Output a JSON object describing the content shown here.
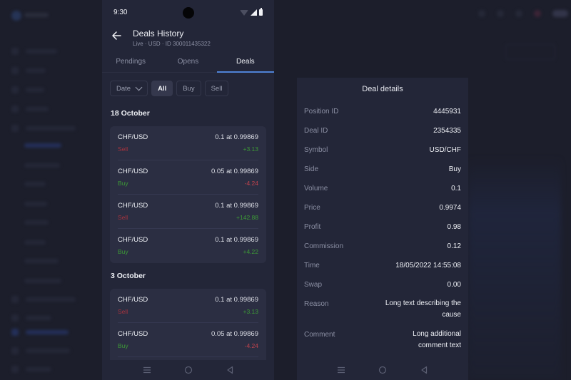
{
  "phone": {
    "status_time": "9:30",
    "header": {
      "title": "Deals History",
      "subtitle": "Live · USD · ID 300011435322"
    },
    "tabs": [
      {
        "label": "Pendings",
        "active": false
      },
      {
        "label": "Opens",
        "active": false
      },
      {
        "label": "Deals",
        "active": true
      }
    ],
    "filters": {
      "date_label": "Date",
      "options": [
        {
          "label": "All",
          "active": true
        },
        {
          "label": "Buy",
          "active": false
        },
        {
          "label": "Sell",
          "active": false
        }
      ]
    },
    "groups": [
      {
        "title": "18 October",
        "deals": [
          {
            "symbol": "CHF/USD",
            "side": "Sell",
            "volume_price": "0.1 at 0.99869",
            "pl": "+3.13"
          },
          {
            "symbol": "CHF/USD",
            "side": "Buy",
            "volume_price": "0.05 at 0.99869",
            "pl": "-4.24"
          },
          {
            "symbol": "CHF/USD",
            "side": "Sell",
            "volume_price": "0.1 at 0.99869",
            "pl": "+142.88"
          },
          {
            "symbol": "CHF/USD",
            "side": "Buy",
            "volume_price": "0.1 at 0.99869",
            "pl": "+4.22"
          }
        ]
      },
      {
        "title": "3 October",
        "deals": [
          {
            "symbol": "CHF/USD",
            "side": "Sell",
            "volume_price": "0.1 at 0.99869",
            "pl": "+3.13"
          },
          {
            "symbol": "CHF/USD",
            "side": "Buy",
            "volume_price": "0.05 at 0.99869",
            "pl": "-4.24"
          }
        ]
      }
    ]
  },
  "deal_details": {
    "title": "Deal details",
    "rows": [
      {
        "label": "Position ID",
        "value": "4445931"
      },
      {
        "label": "Deal ID",
        "value": "2354335"
      },
      {
        "label": "Symbol",
        "value": "USD/CHF"
      },
      {
        "label": "Side",
        "value": "Buy"
      },
      {
        "label": "Volume",
        "value": "0.1"
      },
      {
        "label": "Price",
        "value": "0.9974"
      },
      {
        "label": "Profit",
        "value": "0.98"
      },
      {
        "label": "Commission",
        "value": "0.12"
      },
      {
        "label": "Time",
        "value": "18/05/2022 14:55:08"
      },
      {
        "label": "Swap",
        "value": "0.00"
      },
      {
        "label": "Reason",
        "value": "Long text describing the cause"
      },
      {
        "label": "Comment",
        "value": "Long additional comment text"
      }
    ]
  },
  "colors": {
    "accent": "#4f83d6",
    "buy": "#3d9a37",
    "sell": "#a7333e",
    "negative": "#c2434d",
    "background": "#1c1e2b",
    "panel": "#232638",
    "card": "#2b2e42"
  },
  "icons": {
    "back": "arrow-left-icon",
    "date_dropdown": "chevron-down-icon",
    "nav_recents": "menu-lines-icon",
    "nav_home": "circle-icon",
    "nav_back": "triangle-back-icon"
  }
}
